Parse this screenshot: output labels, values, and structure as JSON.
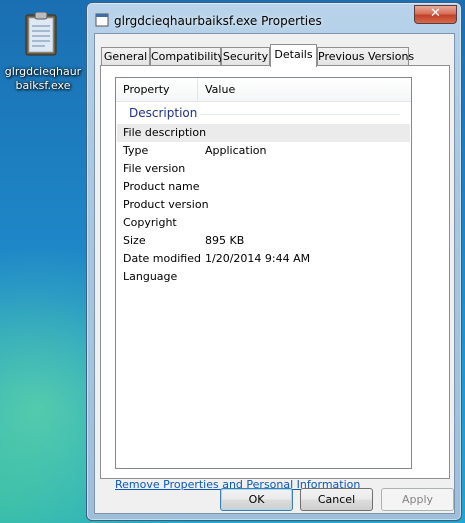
{
  "desktop": {
    "icon_label": "glrgdcieqhaurbaiksf.exe"
  },
  "window": {
    "title": "glrgdcieqhaurbaiksf.exe Properties",
    "close_glyph": "✕"
  },
  "tabs": [
    {
      "label": "General"
    },
    {
      "label": "Compatibility"
    },
    {
      "label": "Security"
    },
    {
      "label": "Details"
    },
    {
      "label": "Previous Versions"
    }
  ],
  "details": {
    "col_property": "Property",
    "col_value": "Value",
    "group": "Description",
    "rows": [
      {
        "key": "File description",
        "value": ""
      },
      {
        "key": "Type",
        "value": "Application"
      },
      {
        "key": "File version",
        "value": ""
      },
      {
        "key": "Product name",
        "value": ""
      },
      {
        "key": "Product version",
        "value": ""
      },
      {
        "key": "Copyright",
        "value": ""
      },
      {
        "key": "Size",
        "value": "895 KB"
      },
      {
        "key": "Date modified",
        "value": "1/20/2014 9:44 AM"
      },
      {
        "key": "Language",
        "value": ""
      }
    ]
  },
  "link": "Remove Properties and Personal Information",
  "buttons": {
    "ok": "OK",
    "cancel": "Cancel",
    "apply": "Apply"
  },
  "colors": {
    "accent_link": "#0b58b8",
    "group_header": "#1e3287",
    "close_red": "#c1402a"
  }
}
